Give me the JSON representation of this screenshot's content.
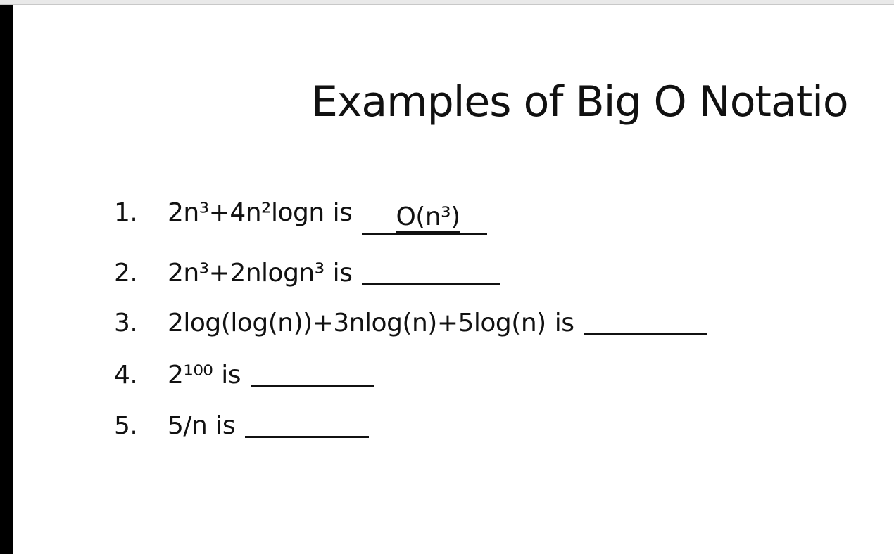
{
  "slide": {
    "title": "Examples of Big O Notatio",
    "items": [
      {
        "number": "1.",
        "expression": "2n³+4n²logn",
        "is": "is",
        "answer": "O(n³)"
      },
      {
        "number": "2.",
        "expression": "2n³+2nlogn³",
        "is": "is",
        "answer": ""
      },
      {
        "number": "3.",
        "expression": "2log(log(n))+3nlog(n)+5log(n)",
        "is": "is",
        "answer": ""
      },
      {
        "number": "4.",
        "expression": "2¹⁰⁰",
        "is": "is",
        "answer": ""
      },
      {
        "number": "5.",
        "expression": "5/n",
        "is": "is",
        "answer": ""
      }
    ]
  }
}
